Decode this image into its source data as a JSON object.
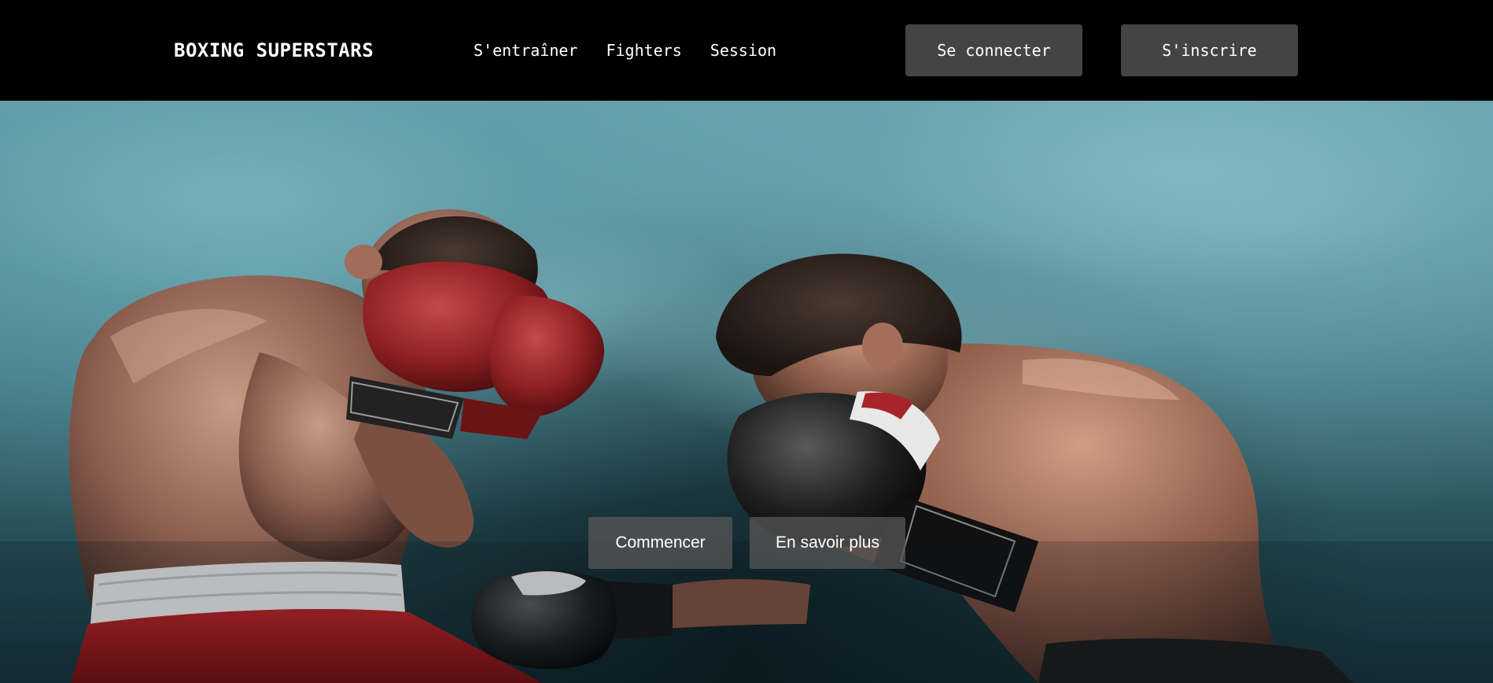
{
  "header": {
    "logo": "BOXING SUPERSTARS",
    "nav": [
      "S'entraîner",
      "Fighters",
      "Session"
    ],
    "login_label": "Se connecter",
    "signup_label": "S'inscrire"
  },
  "hero": {
    "image_subject": "two-boxers-sparring-photo",
    "primary_cta": "Commencer",
    "secondary_cta": "En savoir plus"
  }
}
